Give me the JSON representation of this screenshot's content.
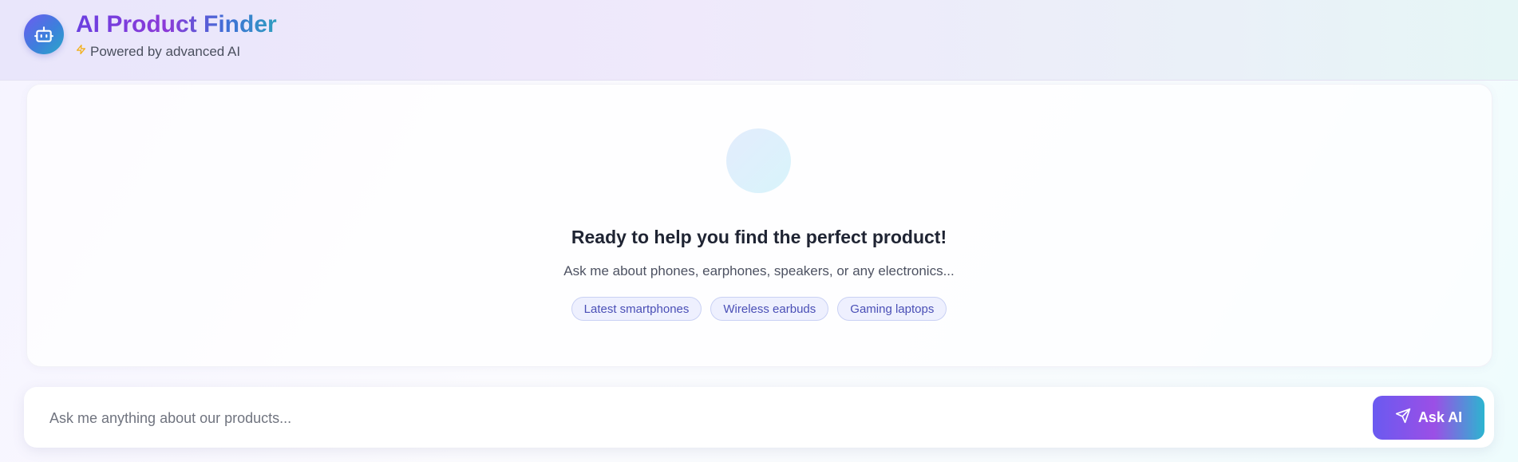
{
  "header": {
    "title": "AI Product Finder",
    "subtitle": "Powered by advanced AI",
    "logo_icon": "robot-icon",
    "subtitle_icon": "lightning-icon"
  },
  "main": {
    "hero_icon": "empty-circle-icon",
    "headline": "Ready to help you find the perfect product!",
    "lead": "Ask me about phones, earphones, speakers, or any electronics...",
    "suggestions": [
      {
        "label": "Latest smartphones"
      },
      {
        "label": "Wireless earbuds"
      },
      {
        "label": "Gaming laptops"
      }
    ]
  },
  "input": {
    "value": "",
    "placeholder": "Ask me anything about our products...",
    "button_label": "Ask AI",
    "button_icon": "send-icon"
  },
  "colors": {
    "accent_purple": "#6a3fe0",
    "accent_teal": "#2cb5d0",
    "chip_text": "#4a4fb6",
    "chip_bg": "#eef0fe",
    "lightning": "#f2b01e"
  }
}
